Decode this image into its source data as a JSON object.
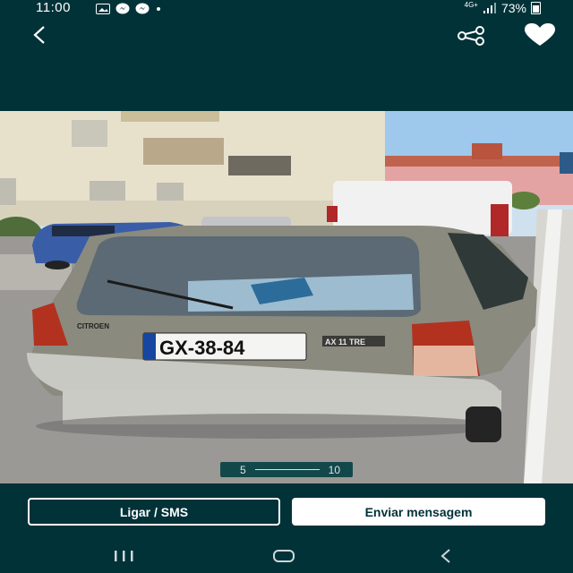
{
  "status_bar": {
    "time": "11:00",
    "network": "4G+",
    "battery": "73%"
  },
  "header": {
    "back_icon": "chevron-left-icon",
    "share_icon": "share-icon",
    "favorite_icon": "heart-icon"
  },
  "photo": {
    "description_icon": "car-photo",
    "plate": "GX-38-84",
    "brand_badge": "CITROEN",
    "model_badge": "AX 11 TRE"
  },
  "gallery_counter": {
    "current": "5",
    "total": "10"
  },
  "actions": {
    "call_label": "Ligar / SMS",
    "message_label": "Enviar mensagem"
  },
  "nav": {
    "recent_icon": "recent-apps-icon",
    "home_icon": "home-icon",
    "back_icon": "back-icon"
  },
  "colors": {
    "background": "#003238",
    "counter_bg": "#13484a",
    "button_text": "#003238"
  }
}
